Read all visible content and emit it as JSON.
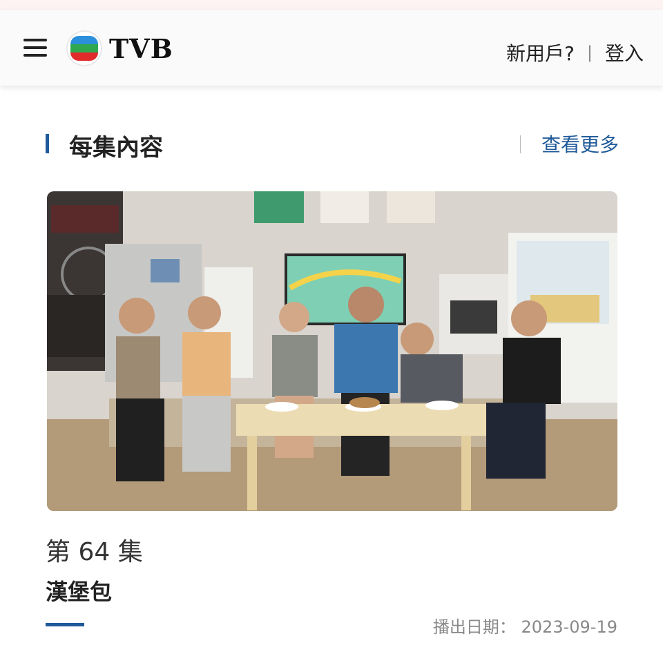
{
  "header": {
    "logo_text": "TVB",
    "new_user_label": "新用戶?",
    "separator": "|",
    "login_label": "登入"
  },
  "section": {
    "title": "每集內容",
    "more_label": "查看更多"
  },
  "episode": {
    "number_label": "第 64 集",
    "title": "漢堡包",
    "air_date_label": "播出日期：",
    "air_date": "2023-09-19"
  },
  "colors": {
    "accent": "#1f5a99",
    "text": "#222222",
    "muted": "#888888"
  },
  "icons": [
    "menu-icon",
    "tvb-logo-icon"
  ]
}
